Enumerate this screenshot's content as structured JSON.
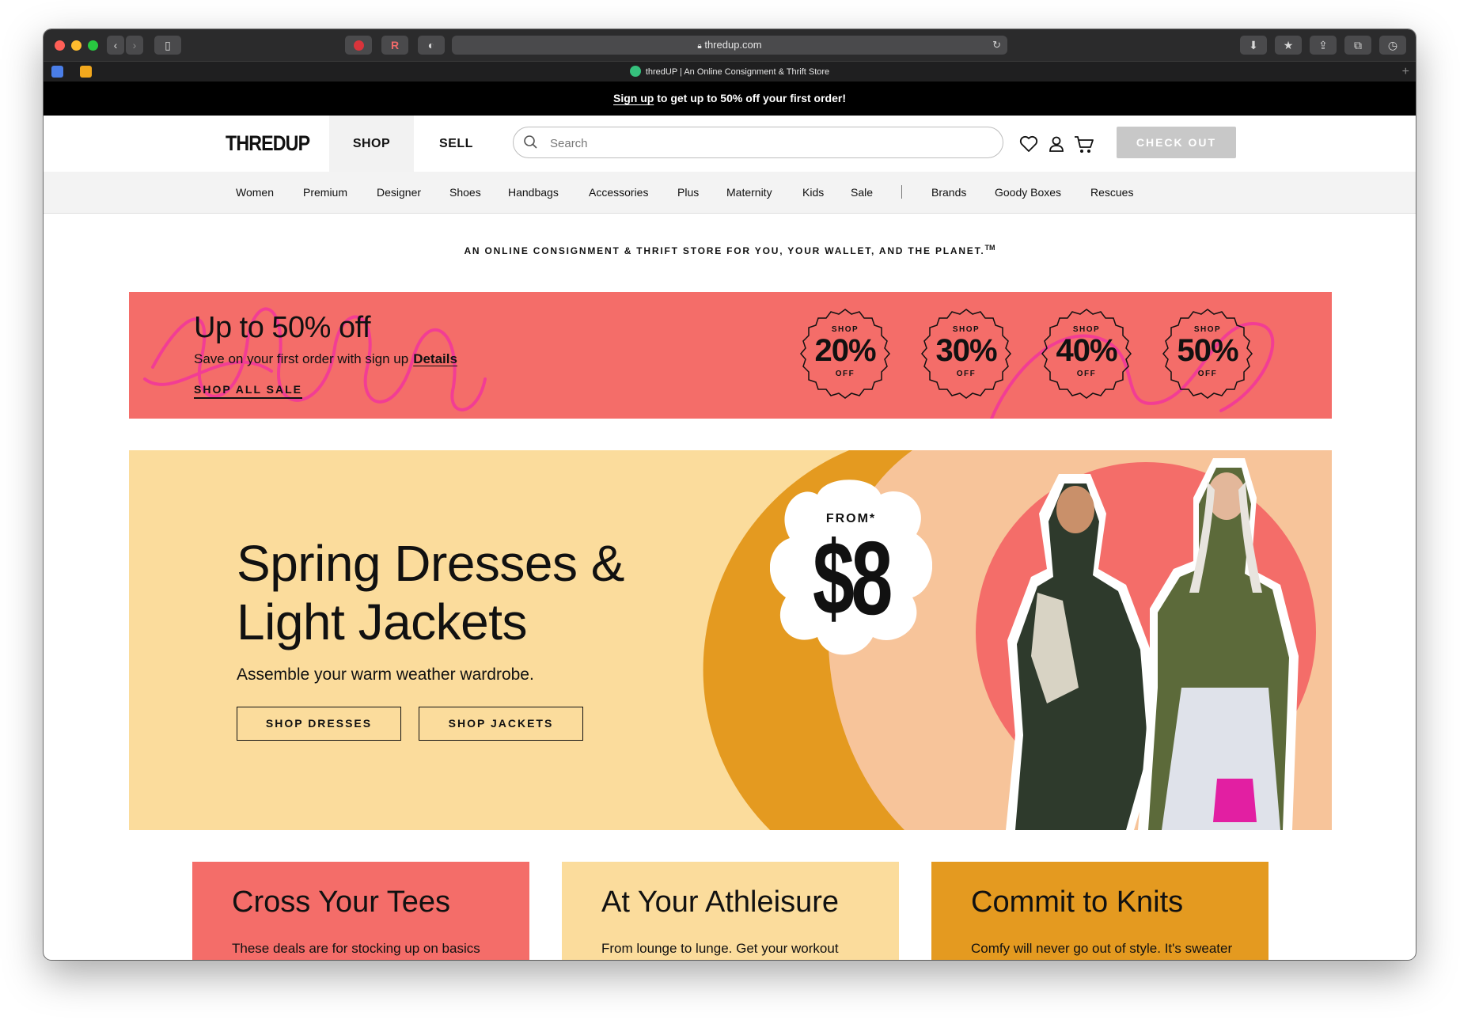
{
  "browser": {
    "url": "thredup.com",
    "tab_title": "thredUP | An Online Consignment & Thrift Store"
  },
  "promo": {
    "link": "Sign up",
    "text": " to get up to 50% off your first order!"
  },
  "header": {
    "logo": "THREDUP",
    "shop": "SHOP",
    "sell": "SELL",
    "search_placeholder": "Search",
    "checkout": "CHECK OUT"
  },
  "categories": [
    "Women",
    "Premium",
    "Designer",
    "Shoes",
    "Handbags",
    "Accessories",
    "Plus",
    "Maternity",
    "Kids",
    "Sale",
    "Brands",
    "Goody Boxes",
    "Rescues"
  ],
  "tagline": "AN ONLINE CONSIGNMENT & THRIFT STORE FOR YOU, YOUR WALLET, AND THE PLANET.",
  "tagline_mark": "TM",
  "sale_banner": {
    "title": "Up to 50% off",
    "subtitle": "Save on your first order with sign up",
    "details": "Details",
    "shop_all": "SHOP ALL SALE",
    "badges": [
      {
        "top": "SHOP",
        "pct": "20%",
        "bottom": "OFF"
      },
      {
        "top": "SHOP",
        "pct": "30%",
        "bottom": "OFF"
      },
      {
        "top": "SHOP",
        "pct": "40%",
        "bottom": "OFF"
      },
      {
        "top": "SHOP",
        "pct": "50%",
        "bottom": "OFF"
      }
    ]
  },
  "hero": {
    "title_line1": "Spring Dresses &",
    "title_line2": "Light Jackets",
    "subtitle": "Assemble your warm weather wardrobe.",
    "btn_dresses": "SHOP DRESSES",
    "btn_jackets": "SHOP JACKETS",
    "from": "FROM*",
    "price": "$8"
  },
  "cards": [
    {
      "title": "Cross Your Tees",
      "text": "These deals are for stocking up on basics",
      "color": "#f46d69"
    },
    {
      "title": "At Your Athleisure",
      "text": "From lounge to lunge. Get your workout",
      "color": "#fbdc9c"
    },
    {
      "title": "Commit to Knits",
      "text": "Comfy will never go out of style. It's sweater",
      "color": "#e49a20"
    }
  ],
  "colors": {
    "coral": "#f46d69",
    "cream": "#fbdc9c",
    "mustard": "#e49a20",
    "peach": "#f7c49a",
    "pink_scribble": "#f23d94"
  }
}
